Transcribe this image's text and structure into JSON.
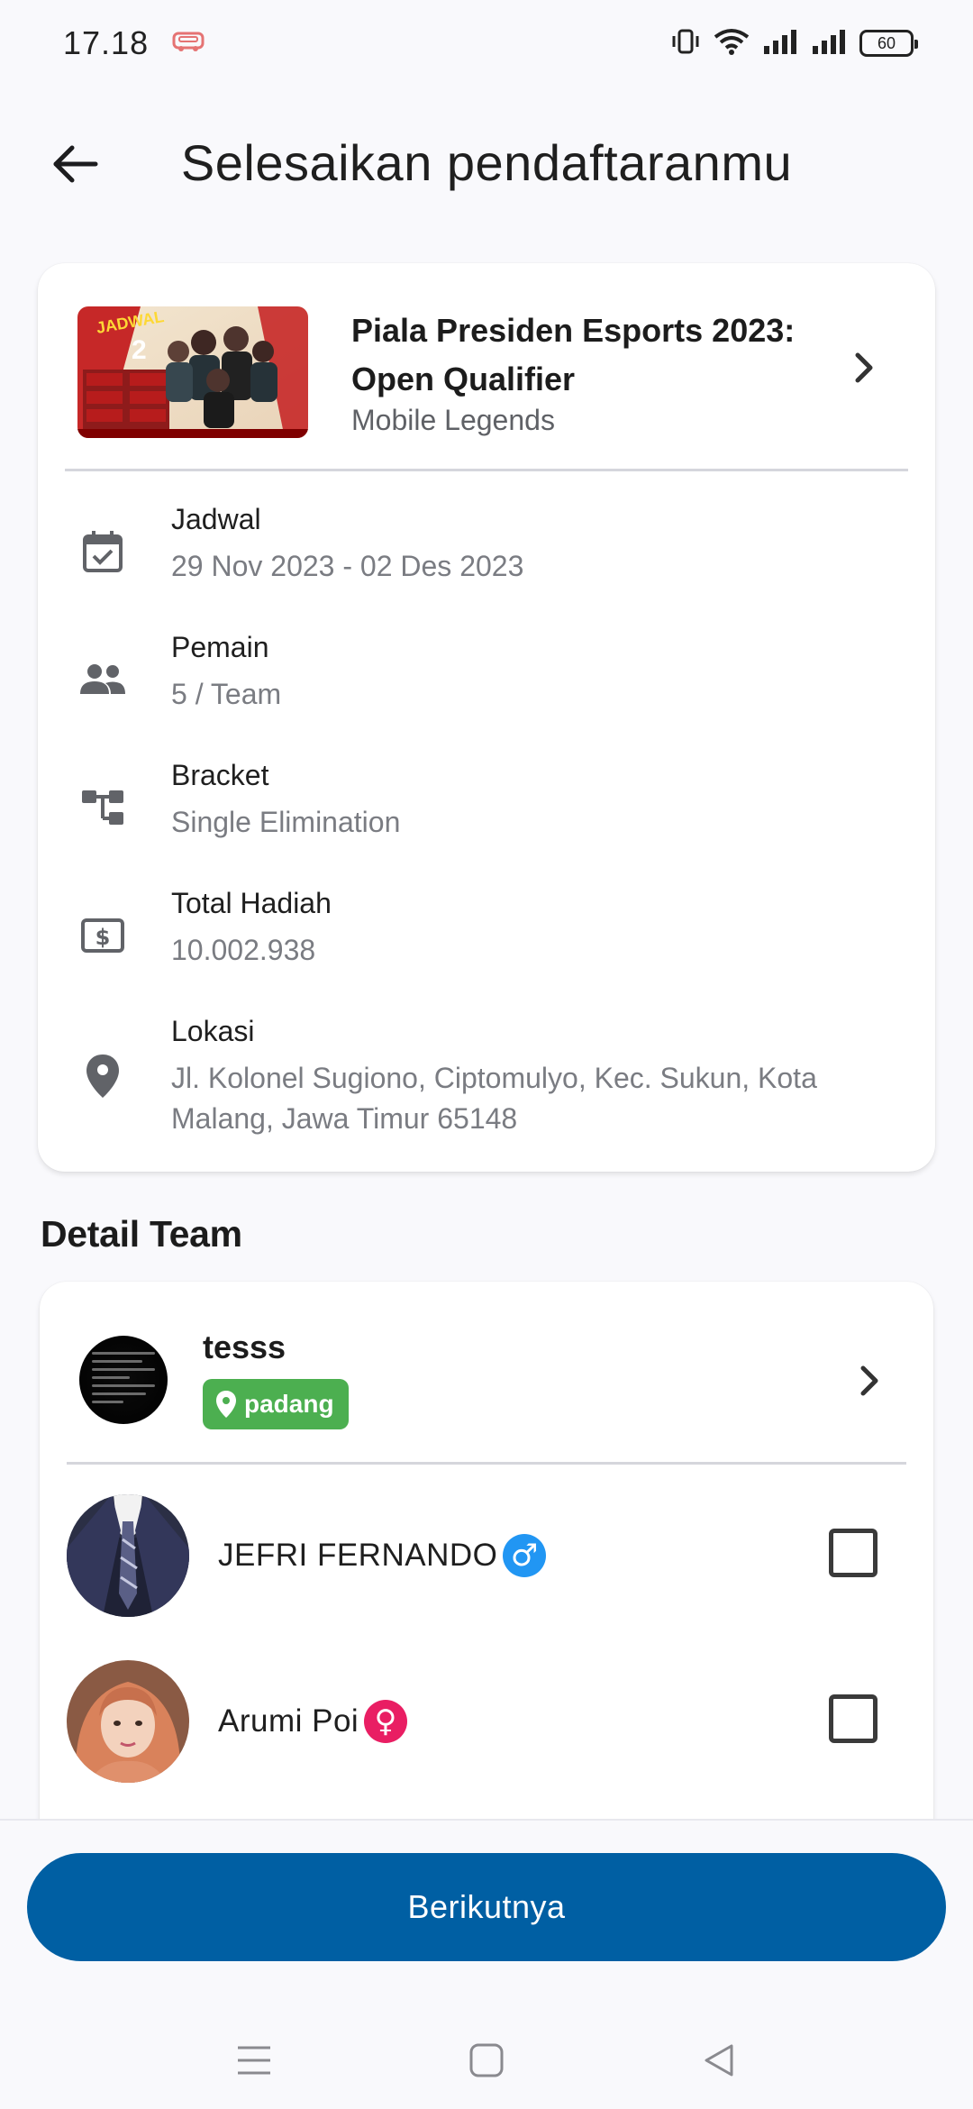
{
  "status_bar": {
    "time": "17.18",
    "battery": "60"
  },
  "header": {
    "title": "Selesaikan pendaftaranmu"
  },
  "event": {
    "name": "Piala Presiden Esports 2023: Open Qualifier",
    "game": "Mobile Legends",
    "info": [
      {
        "icon": "calendar-check-icon",
        "label": "Jadwal",
        "value": "29 Nov 2023 - 02 Des 2023"
      },
      {
        "icon": "group-icon",
        "label": "Pemain",
        "value": "5 / Team"
      },
      {
        "icon": "bracket-icon",
        "label": "Bracket",
        "value": "Single Elimination"
      },
      {
        "icon": "money-icon",
        "label": "Total Hadiah",
        "value": "10.002.938"
      },
      {
        "icon": "location-pin-icon",
        "label": "Lokasi",
        "value": "Jl. Kolonel Sugiono, Ciptomulyo, Kec. Sukun, Kota Malang, Jawa Timur 65148"
      }
    ]
  },
  "team_section": {
    "title": "Detail Team",
    "team_name": "tesss",
    "team_location": "padang",
    "members": [
      {
        "name": "JEFRI FERNANDO",
        "gender": "male",
        "gender_symbol": "♂",
        "checked": false
      },
      {
        "name": "Arumi Poi",
        "gender": "female",
        "gender_symbol": "♀",
        "checked": false
      }
    ]
  },
  "footer": {
    "next_label": "Berikutnya"
  },
  "colors": {
    "primary": "#005fa3",
    "badge_green": "#4caf50",
    "male": "#2196f3",
    "female": "#e91e63"
  }
}
